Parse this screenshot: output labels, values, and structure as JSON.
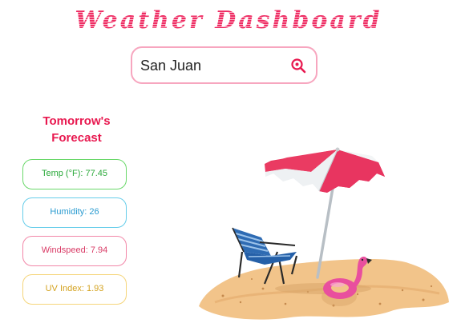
{
  "header": {
    "title": "Weather Dashboard"
  },
  "search": {
    "value": "San Juan",
    "icon": "search-icon"
  },
  "forecast": {
    "title": "Tomorrow's Forecast",
    "cards": [
      {
        "label": "Temp (°F): 77.45",
        "color": "#2aa93a"
      },
      {
        "label": "Humidity: 26",
        "color": "#2a9bd0"
      },
      {
        "label": "Windspeed: 7.94",
        "color": "#d93b66"
      },
      {
        "label": "UV Index: 1.93",
        "color": "#d4a320"
      }
    ]
  },
  "illustration": {
    "name": "beach-umbrella-chair-flamingo-float"
  },
  "colors": {
    "accent": "#ee2c63",
    "border": "#f7a6bf"
  }
}
